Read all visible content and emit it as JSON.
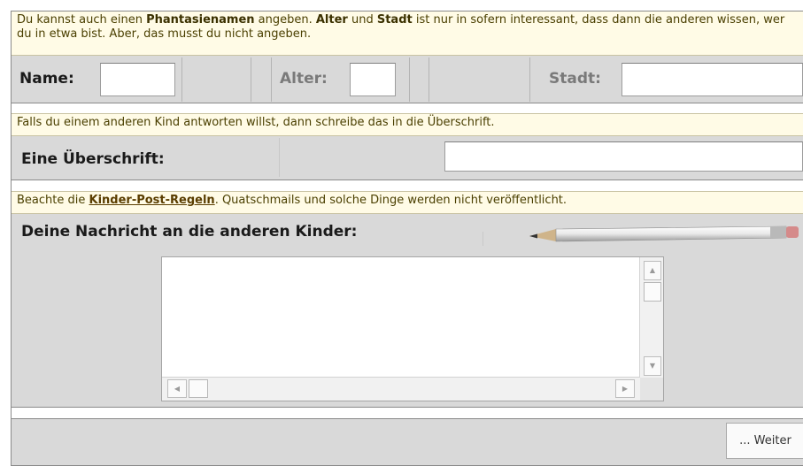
{
  "section_identity": {
    "note_pre": "Du kannst auch einen ",
    "note_b1": "Phantasienamen",
    "note_mid1": " angeben. ",
    "note_b2": "Alter",
    "note_mid2": " und ",
    "note_b3": "Stadt",
    "note_post": " ist nur in sofern interessant, dass dann die anderen wissen, wer du in etwa bist. Aber, das musst du nicht angeben.",
    "name_label": "Name:",
    "age_label": "Alter:",
    "city_label": "Stadt:",
    "name_value": "",
    "age_value": "",
    "city_value": ""
  },
  "section_subject": {
    "note": "Falls du einem anderen Kind antworten willst, dann schreibe das in die Überschrift.",
    "label": "Eine Überschrift:",
    "value": ""
  },
  "section_message": {
    "note_pre": "Beachte die ",
    "note_link": "Kinder-Post-Regeln",
    "note_post": ". Quatschmails und solche Dinge werden nicht veröffentlicht.",
    "label": "Deine Nachricht an die anderen Kinder:",
    "value": "",
    "decoration_icon": "pencil-icon"
  },
  "footer": {
    "next_button": "... Weiter"
  },
  "colors": {
    "note_bg": "#fffbe6",
    "panel_bg": "#d9d9d9",
    "note_text": "#4a3f00"
  }
}
